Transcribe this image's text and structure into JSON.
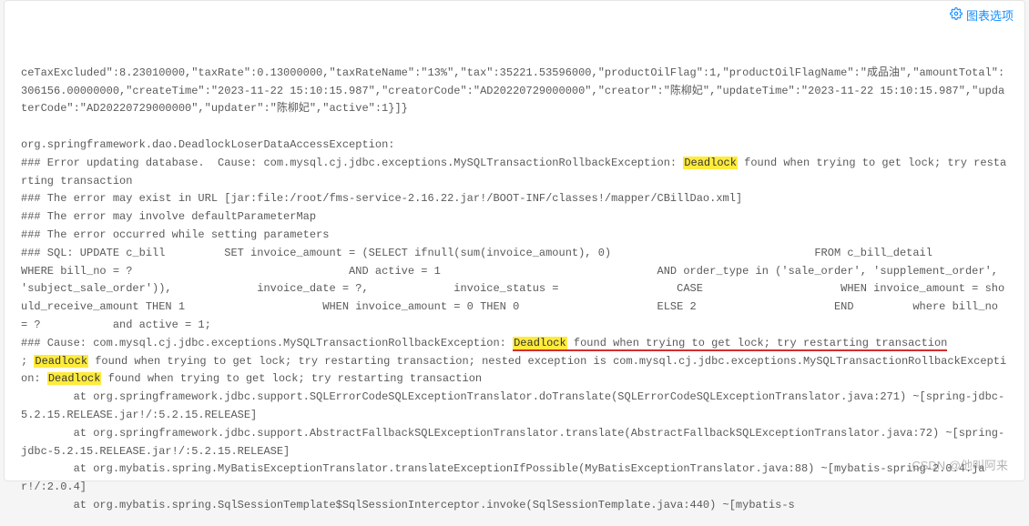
{
  "toolbar": {
    "options_label": "图表选项"
  },
  "log": {
    "l1": "ceTaxExcluded\":8.23010000,\"taxRate\":0.13000000,\"taxRateName\":\"13%\",\"tax\":35221.53596000,\"productOilFlag\":1,\"productOilFlagName\":\"成品油\",\"amountTotal\":306156.00000000,\"createTime\":\"2023-11-22 15:10:15.987\",\"creatorCode\":\"AD20220729000000\",\"creator\":\"陈柳妃\",\"updateTime\":\"2023-11-22 15:10:15.987\",\"updaterCode\":\"AD20220729000000\",\"updater\":\"陈柳妃\",\"active\":1}]}",
    "l2": "org.springframework.dao.DeadlockLoserDataAccessException:",
    "l3a": "### Error updating database.  Cause: com.mysql.cj.jdbc.exceptions.MySQLTransactionRollbackException: ",
    "l3b": " found when trying to get lock; try restarting transaction",
    "l4": "### The error may exist in URL [jar:file:/root/fms-service-2.16.22.jar!/BOOT-INF/classes!/mapper/CBillDao.xml]",
    "l5": "### The error may involve defaultParameterMap",
    "l6": "### The error occurred while setting parameters",
    "l7": "### SQL: UPDATE c_bill         SET invoice_amount = (SELECT ifnull(sum(invoice_amount), 0)                               FROM c_bill_detail                               WHERE bill_no = ?                                 AND active = 1                                 AND order_type in ('sale_order', 'supplement_order', 'subject_sale_order')),             invoice_date = ?,             invoice_status =                  CASE                     WHEN invoice_amount = should_receive_amount THEN 1                     WHEN invoice_amount = 0 THEN 0                     ELSE 2                     END         where bill_no = ?           and active = 1;",
    "l8a": "### Cause: com.mysql.cj.jdbc.exceptions.MySQLTransactionRollbackException: ",
    "l8b": " found when trying to get lock; try restarting transaction",
    "l9a": "; ",
    "l9b": " found when trying to get lock; try restarting transaction; nested exception is com.mysql.cj.jdbc.exceptions.MySQLTransactionRollbackException: ",
    "l9c": " found when trying to get lock; try restarting transaction",
    "l10": "        at org.springframework.jdbc.support.SQLErrorCodeSQLExceptionTranslator.doTranslate(SQLErrorCodeSQLExceptionTranslator.java:271) ~[spring-jdbc-5.2.15.RELEASE.jar!/:5.2.15.RELEASE]",
    "l11": "        at org.springframework.jdbc.support.AbstractFallbackSQLExceptionTranslator.translate(AbstractFallbackSQLExceptionTranslator.java:72) ~[spring-jdbc-5.2.15.RELEASE.jar!/:5.2.15.RELEASE]",
    "l12": "        at org.mybatis.spring.MyBatisExceptionTranslator.translateExceptionIfPossible(MyBatisExceptionTranslator.java:88) ~[mybatis-spring-2.0.4.jar!/:2.0.4]",
    "l13": "        at org.mybatis.spring.SqlSessionTemplate$SqlSessionInterceptor.invoke(SqlSessionTemplate.java:440) ~[mybatis-s",
    "deadlock": "Deadlock"
  },
  "watermark": "CSDN @他叫阿来"
}
